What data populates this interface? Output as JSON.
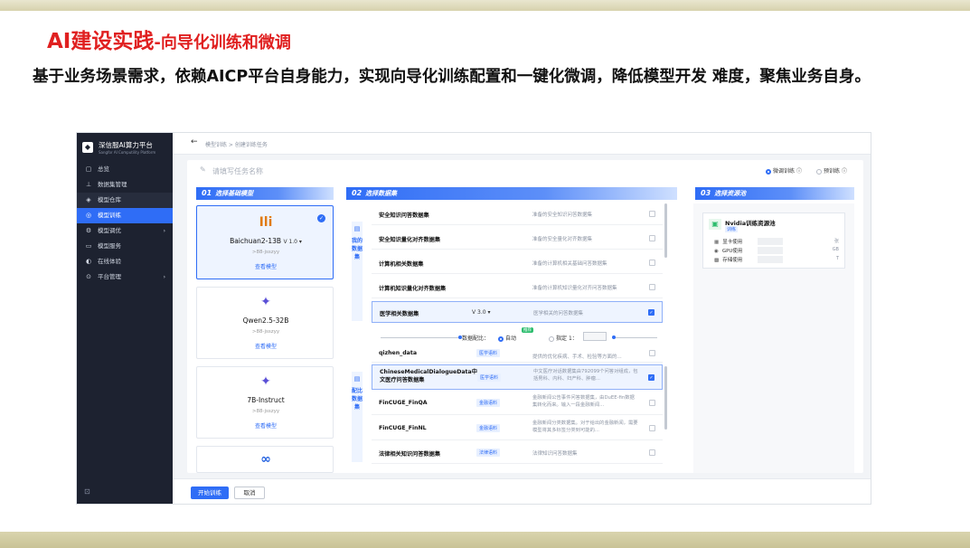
{
  "slide": {
    "title_main": "AI建设实践",
    "title_sub": "-向导化训练和微调",
    "subtitle": "基于业务场景需求，依赖AICP平台自身能力，实现向导化训练配置和一键化微调，降低模型开发 难度，聚焦业务自身。"
  },
  "app": {
    "brand_name": "深信服AI算力平台",
    "brand_sub": "Sangfor AI Computility Platform",
    "nav": [
      {
        "label": "总览",
        "icon": "▢"
      },
      {
        "label": "数据集管理",
        "icon": "⊥"
      },
      {
        "label": "模型仓库",
        "icon": "◈"
      },
      {
        "label": "模型训练",
        "icon": "◎"
      },
      {
        "label": "模型调优",
        "icon": "⚙",
        "arrow": "›"
      },
      {
        "label": "模型服务",
        "icon": "▭"
      },
      {
        "label": "在线体验",
        "icon": "◐"
      },
      {
        "label": "平台管理",
        "icon": "⊙",
        "arrow": "›"
      }
    ],
    "footer_icon": "⊡"
  },
  "breadcrumb": {
    "back": "←",
    "path": "模型训练 > 创建训练任务"
  },
  "form": {
    "name_placeholder": "请填写任务名称",
    "pen_icon": "✎",
    "mode_options": [
      "微调训练",
      "预训练"
    ],
    "info_icon": "ⓘ"
  },
  "steps": [
    {
      "num": "01",
      "label": "选择基础模型"
    },
    {
      "num": "02",
      "label": "选择数据集"
    },
    {
      "num": "03",
      "label": "选择资源池"
    }
  ],
  "models": [
    {
      "logo": "Ili",
      "name": "Baichuan2-13B",
      "version": "V 1.0 ▾",
      "user": ">88-jsszyy",
      "link": "查看模型",
      "selected": true
    },
    {
      "logo": "✦",
      "name": "Qwen2.5-32B",
      "version": "",
      "user": ">88-jsszyy",
      "link": "查看模型",
      "selected": false
    },
    {
      "logo": "✦",
      "name": "7B-Instruct",
      "version": "",
      "user": ">88-jsszyy",
      "link": "查看模型",
      "selected": false
    },
    {
      "logo": "∞",
      "name": "",
      "version": "",
      "user": "",
      "link": "",
      "selected": false
    }
  ],
  "dataset_tags": {
    "mine": "我的数据集",
    "mix": "配比数据集",
    "icon": "▤"
  },
  "datasets_mine": [
    {
      "name": "安全知识问答数据集",
      "desc": "准备的安全知识问答数据集",
      "checked": false
    },
    {
      "name": "安全知识量化对齐数据集",
      "desc": "准备的安全量化对齐数据集",
      "checked": false
    },
    {
      "name": "计算机相关数据集",
      "desc": "准备的计算机相关基础问答数据集",
      "checked": false
    },
    {
      "name": "计算机知识量化对齐数据集",
      "desc": "准备的计算机知识量化对齐问答数据集",
      "checked": false
    },
    {
      "name": "医学相关数据集",
      "version": "V 3.0 ▾",
      "desc": "医学相关的问答数据集",
      "checked": true
    }
  ],
  "ratio": {
    "label": "数据配比：",
    "auto": "自动",
    "badge": "推荐",
    "specify": "指定",
    "ratio_prefix": "1："
  },
  "datasets_mix": [
    {
      "name": "qizhen_data",
      "desc": "提供的优化疾病、手术、检验等方面的...",
      "tag": "医学语料",
      "checked": false
    },
    {
      "name": "ChineseMedicalDialogueData中文医疗问答数据集",
      "tag": "医学语料",
      "desc": "中文医疗对话数据集由792099个问答对组成，包括男科、内科、妇产科、肿瘤...",
      "checked": true
    },
    {
      "name": "FinCUGE_FinQA",
      "tag": "金融语料",
      "desc": "金融新闻公告事件问答数据集，由DuEE-fin数据集转化而来。输入一段金融新闻...",
      "checked": false
    },
    {
      "name": "FinCUGE_FinNL",
      "tag": "金融语料",
      "desc": "金融新闻分类数据集。对于给出的金融新闻，需要模型将其多标签分类到可能的...",
      "checked": false
    },
    {
      "name": "法律相关知识问答数据集",
      "tag": "法律语料",
      "desc": "法律知识问答数据集",
      "checked": false
    }
  ],
  "resource": {
    "name": "Nvidia训练资源池",
    "tag": "训练",
    "icon": "▣",
    "rows": [
      {
        "icon": "▦",
        "label": "显卡使用",
        "unit": "张"
      },
      {
        "icon": "◉",
        "label": "GPU使用",
        "unit": "GB"
      },
      {
        "icon": "▩",
        "label": "存储使用",
        "unit": "T"
      }
    ]
  },
  "actions": {
    "start": "开始训练",
    "cancel": "取消"
  }
}
